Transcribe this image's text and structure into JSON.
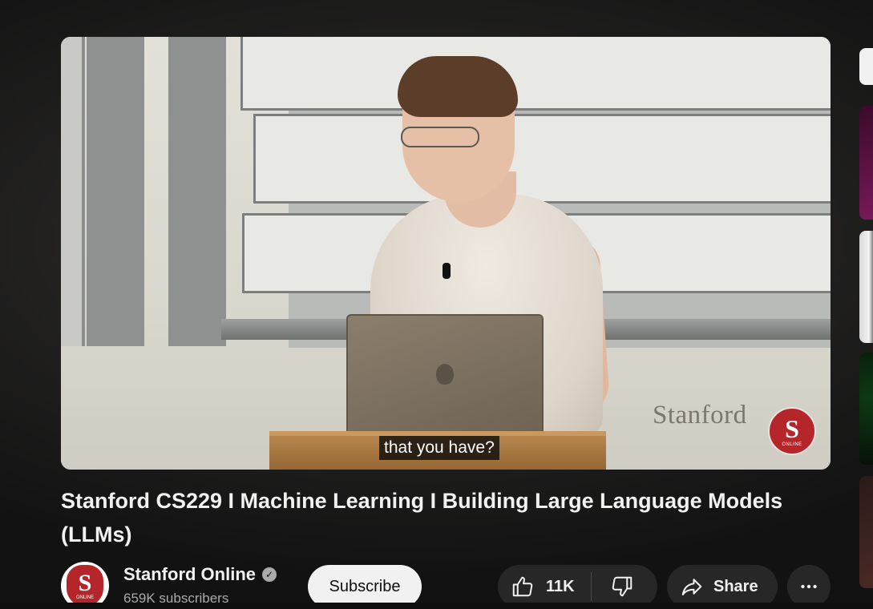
{
  "video": {
    "caption": "that you have?",
    "watermark_text": "Stanford",
    "logo_text": "S",
    "logo_subtext": "ONLINE"
  },
  "title": "Stanford CS229 I Machine Learning I Building Large Language Models (LLMs)",
  "channel": {
    "name": "Stanford Online",
    "verified": true,
    "subscribers": "659K subscribers",
    "avatar_letter": "S",
    "avatar_subtext": "ONLINE"
  },
  "actions": {
    "subscribe_label": "Subscribe",
    "like_count": "11K",
    "share_label": "Share"
  },
  "icons": {
    "like": "thumbs-up-icon",
    "dislike": "thumbs-down-icon",
    "share": "share-arrow-icon",
    "more": "more-horizontal-icon",
    "verified": "verified-check-icon"
  },
  "colors": {
    "background": "#0f0f0f",
    "pill": "#272727",
    "subscribe_bg": "#f1f1f1",
    "brand_red": "#b5262b"
  }
}
